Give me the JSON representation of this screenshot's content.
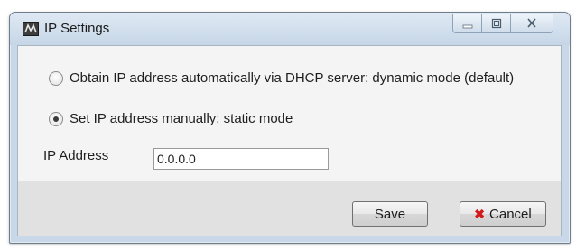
{
  "window": {
    "title": "IP Settings",
    "icons": {
      "app": "network-app-icon",
      "minimize": "minimize-icon",
      "maximize": "maximize-icon",
      "close": "close-icon"
    }
  },
  "options": {
    "dhcp_label": "Obtain IP address automatically via DHCP server: dynamic mode (default)",
    "dhcp_selected": false,
    "static_label": "Set IP address manually: static mode",
    "static_selected": true
  },
  "ip_field": {
    "label": "IP Address",
    "value": "0.0.0.0"
  },
  "buttons": {
    "save_label": "Save",
    "cancel_label": "Cancel",
    "cancel_icon": "x-icon",
    "cancel_icon_color": "#d21a1a"
  }
}
